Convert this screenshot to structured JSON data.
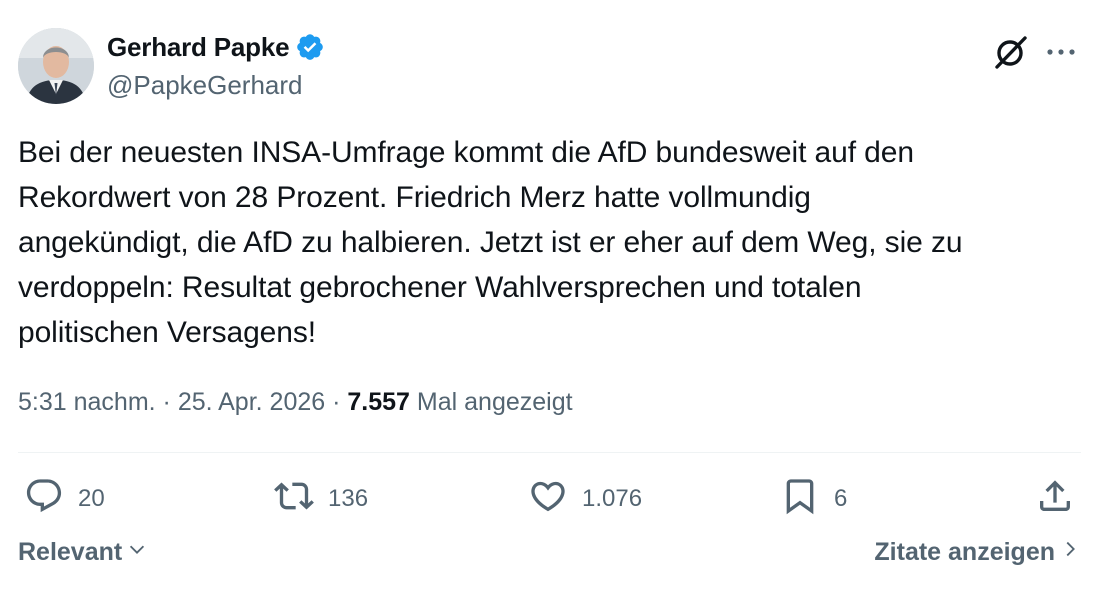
{
  "author": {
    "name": "Gerhard Papke",
    "handle": "@PapkeGerhard",
    "verified": true,
    "verified_color": "#1d9bf0"
  },
  "tweet": {
    "text": "Bei der neuesten INSA-Umfrage kommt die AfD bundesweit auf den\nRekordwert von 28 Prozent. Friedrich Merz hatte vollmundig\nangekündigt, die AfD zu halbieren. Jetzt ist er eher auf dem Weg, sie zu\nverdoppeln: Resultat gebrochener Wahlversprechen und totalen\npolitischen Versagens!"
  },
  "meta": {
    "time": "5:31 nachm.",
    "separator": " · ",
    "date": "25. Apr. 2026",
    "views_count": "7.557",
    "views_label": "Mal angezeigt"
  },
  "actions": {
    "replies": "20",
    "reposts": "136",
    "likes": "1.076",
    "bookmarks": "6"
  },
  "footer": {
    "sort_label": "Relevant",
    "quotes_label": "Zitate anzeigen"
  },
  "icons": {
    "header": [
      "grok-icon",
      "more-icon"
    ],
    "actions": [
      "reply-icon",
      "repost-icon",
      "like-icon",
      "bookmark-icon",
      "share-icon"
    ]
  },
  "colors": {
    "text": "#0f1419",
    "secondary": "#536471",
    "divider": "#eff3f4"
  }
}
